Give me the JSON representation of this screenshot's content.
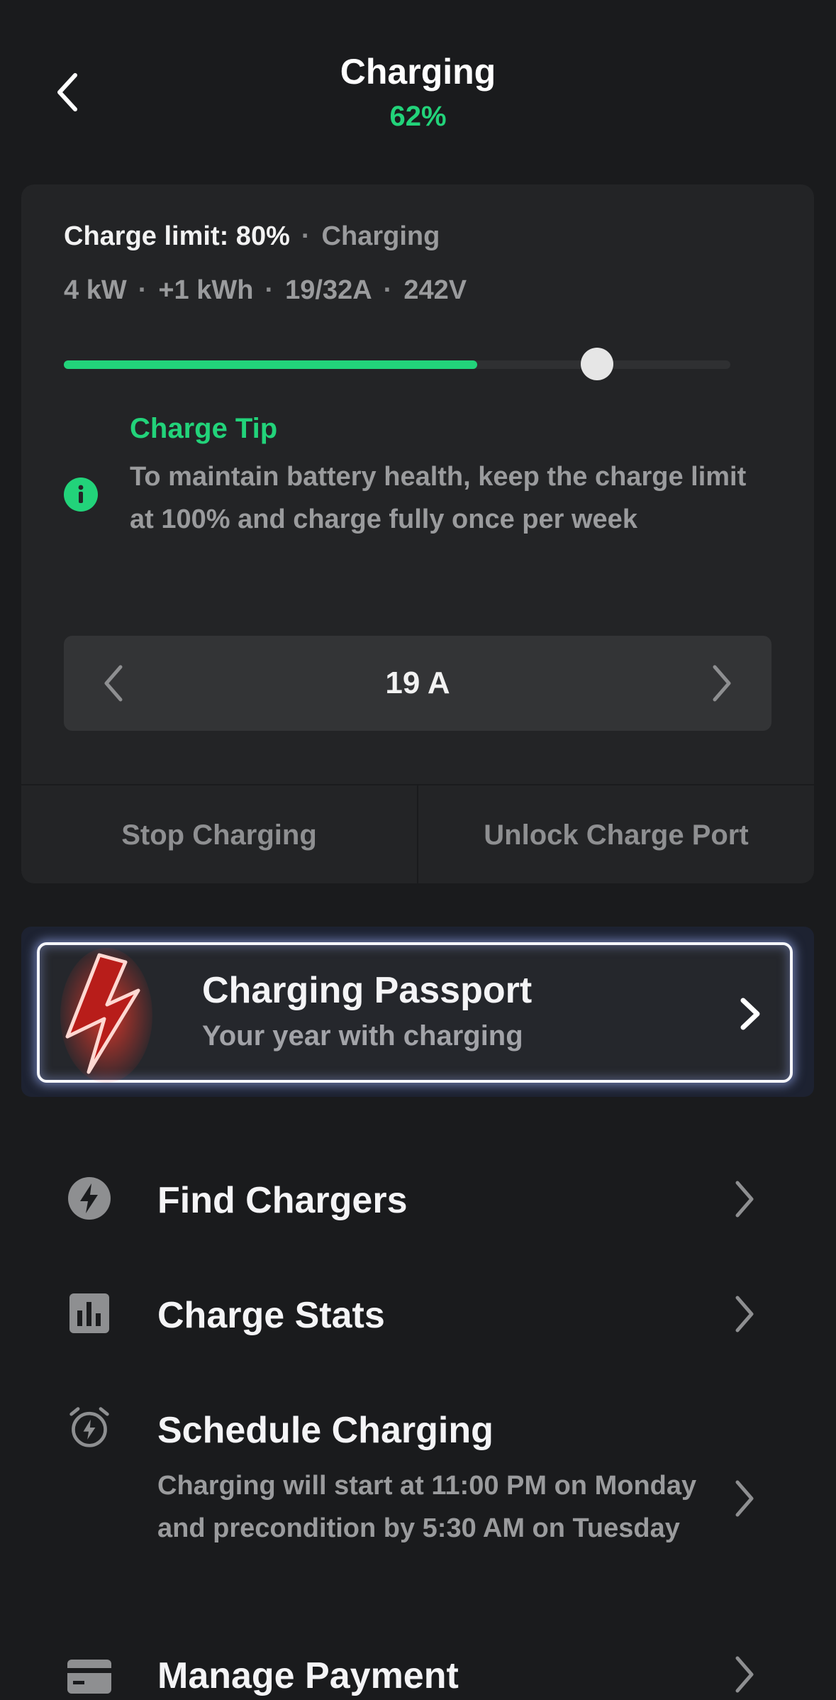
{
  "header": {
    "title": "Charging",
    "battery_percent": "62%"
  },
  "charge_card": {
    "limit_label": "Charge limit: 80%",
    "status": "Charging",
    "power": "4 kW",
    "energy_added": "+1 kWh",
    "amperage": "19/32A",
    "voltage": "242V",
    "current_level": 0.62,
    "charge_limit_level": 0.8,
    "tip_title": "Charge Tip",
    "tip_text": "To maintain battery health, keep the charge limit at 100% and charge fully once per week",
    "amp_value": "19 A",
    "stop_label": "Stop Charging",
    "unlock_label": "Unlock Charge Port"
  },
  "passport": {
    "title": "Charging Passport",
    "subtitle": "Your year with charging"
  },
  "menu": {
    "find_chargers": "Find Chargers",
    "charge_stats": "Charge Stats",
    "schedule_charging": "Schedule Charging",
    "schedule_desc": "Charging will start at 11:00 PM on Monday and precondition by 5:30 AM on Tuesday",
    "manage_payment": "Manage Payment"
  },
  "colors": {
    "accent": "#22d37a",
    "background": "#1a1b1d",
    "card": "#232426"
  },
  "icons": [
    "back-chevron-icon",
    "info-icon",
    "chevron-left-icon",
    "chevron-right-icon",
    "lightning-bolt-icon",
    "bolt-circle-icon",
    "bar-chart-icon",
    "alarm-clock-icon",
    "credit-card-icon"
  ]
}
